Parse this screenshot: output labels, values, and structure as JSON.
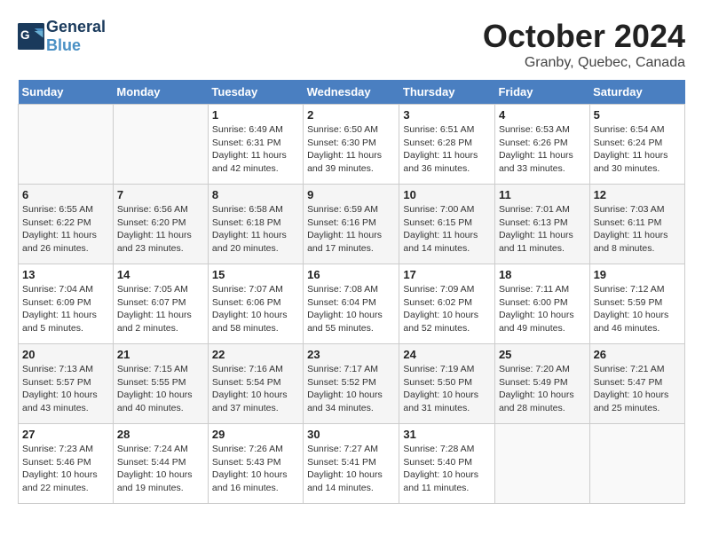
{
  "header": {
    "logo_line1": "General",
    "logo_line2": "Blue",
    "month": "October 2024",
    "location": "Granby, Quebec, Canada"
  },
  "weekdays": [
    "Sunday",
    "Monday",
    "Tuesday",
    "Wednesday",
    "Thursday",
    "Friday",
    "Saturday"
  ],
  "weeks": [
    [
      {
        "day": "",
        "sunrise": "",
        "sunset": "",
        "daylight": ""
      },
      {
        "day": "",
        "sunrise": "",
        "sunset": "",
        "daylight": ""
      },
      {
        "day": "1",
        "sunrise": "Sunrise: 6:49 AM",
        "sunset": "Sunset: 6:31 PM",
        "daylight": "Daylight: 11 hours and 42 minutes."
      },
      {
        "day": "2",
        "sunrise": "Sunrise: 6:50 AM",
        "sunset": "Sunset: 6:30 PM",
        "daylight": "Daylight: 11 hours and 39 minutes."
      },
      {
        "day": "3",
        "sunrise": "Sunrise: 6:51 AM",
        "sunset": "Sunset: 6:28 PM",
        "daylight": "Daylight: 11 hours and 36 minutes."
      },
      {
        "day": "4",
        "sunrise": "Sunrise: 6:53 AM",
        "sunset": "Sunset: 6:26 PM",
        "daylight": "Daylight: 11 hours and 33 minutes."
      },
      {
        "day": "5",
        "sunrise": "Sunrise: 6:54 AM",
        "sunset": "Sunset: 6:24 PM",
        "daylight": "Daylight: 11 hours and 30 minutes."
      }
    ],
    [
      {
        "day": "6",
        "sunrise": "Sunrise: 6:55 AM",
        "sunset": "Sunset: 6:22 PM",
        "daylight": "Daylight: 11 hours and 26 minutes."
      },
      {
        "day": "7",
        "sunrise": "Sunrise: 6:56 AM",
        "sunset": "Sunset: 6:20 PM",
        "daylight": "Daylight: 11 hours and 23 minutes."
      },
      {
        "day": "8",
        "sunrise": "Sunrise: 6:58 AM",
        "sunset": "Sunset: 6:18 PM",
        "daylight": "Daylight: 11 hours and 20 minutes."
      },
      {
        "day": "9",
        "sunrise": "Sunrise: 6:59 AM",
        "sunset": "Sunset: 6:16 PM",
        "daylight": "Daylight: 11 hours and 17 minutes."
      },
      {
        "day": "10",
        "sunrise": "Sunrise: 7:00 AM",
        "sunset": "Sunset: 6:15 PM",
        "daylight": "Daylight: 11 hours and 14 minutes."
      },
      {
        "day": "11",
        "sunrise": "Sunrise: 7:01 AM",
        "sunset": "Sunset: 6:13 PM",
        "daylight": "Daylight: 11 hours and 11 minutes."
      },
      {
        "day": "12",
        "sunrise": "Sunrise: 7:03 AM",
        "sunset": "Sunset: 6:11 PM",
        "daylight": "Daylight: 11 hours and 8 minutes."
      }
    ],
    [
      {
        "day": "13",
        "sunrise": "Sunrise: 7:04 AM",
        "sunset": "Sunset: 6:09 PM",
        "daylight": "Daylight: 11 hours and 5 minutes."
      },
      {
        "day": "14",
        "sunrise": "Sunrise: 7:05 AM",
        "sunset": "Sunset: 6:07 PM",
        "daylight": "Daylight: 11 hours and 2 minutes."
      },
      {
        "day": "15",
        "sunrise": "Sunrise: 7:07 AM",
        "sunset": "Sunset: 6:06 PM",
        "daylight": "Daylight: 10 hours and 58 minutes."
      },
      {
        "day": "16",
        "sunrise": "Sunrise: 7:08 AM",
        "sunset": "Sunset: 6:04 PM",
        "daylight": "Daylight: 10 hours and 55 minutes."
      },
      {
        "day": "17",
        "sunrise": "Sunrise: 7:09 AM",
        "sunset": "Sunset: 6:02 PM",
        "daylight": "Daylight: 10 hours and 52 minutes."
      },
      {
        "day": "18",
        "sunrise": "Sunrise: 7:11 AM",
        "sunset": "Sunset: 6:00 PM",
        "daylight": "Daylight: 10 hours and 49 minutes."
      },
      {
        "day": "19",
        "sunrise": "Sunrise: 7:12 AM",
        "sunset": "Sunset: 5:59 PM",
        "daylight": "Daylight: 10 hours and 46 minutes."
      }
    ],
    [
      {
        "day": "20",
        "sunrise": "Sunrise: 7:13 AM",
        "sunset": "Sunset: 5:57 PM",
        "daylight": "Daylight: 10 hours and 43 minutes."
      },
      {
        "day": "21",
        "sunrise": "Sunrise: 7:15 AM",
        "sunset": "Sunset: 5:55 PM",
        "daylight": "Daylight: 10 hours and 40 minutes."
      },
      {
        "day": "22",
        "sunrise": "Sunrise: 7:16 AM",
        "sunset": "Sunset: 5:54 PM",
        "daylight": "Daylight: 10 hours and 37 minutes."
      },
      {
        "day": "23",
        "sunrise": "Sunrise: 7:17 AM",
        "sunset": "Sunset: 5:52 PM",
        "daylight": "Daylight: 10 hours and 34 minutes."
      },
      {
        "day": "24",
        "sunrise": "Sunrise: 7:19 AM",
        "sunset": "Sunset: 5:50 PM",
        "daylight": "Daylight: 10 hours and 31 minutes."
      },
      {
        "day": "25",
        "sunrise": "Sunrise: 7:20 AM",
        "sunset": "Sunset: 5:49 PM",
        "daylight": "Daylight: 10 hours and 28 minutes."
      },
      {
        "day": "26",
        "sunrise": "Sunrise: 7:21 AM",
        "sunset": "Sunset: 5:47 PM",
        "daylight": "Daylight: 10 hours and 25 minutes."
      }
    ],
    [
      {
        "day": "27",
        "sunrise": "Sunrise: 7:23 AM",
        "sunset": "Sunset: 5:46 PM",
        "daylight": "Daylight: 10 hours and 22 minutes."
      },
      {
        "day": "28",
        "sunrise": "Sunrise: 7:24 AM",
        "sunset": "Sunset: 5:44 PM",
        "daylight": "Daylight: 10 hours and 19 minutes."
      },
      {
        "day": "29",
        "sunrise": "Sunrise: 7:26 AM",
        "sunset": "Sunset: 5:43 PM",
        "daylight": "Daylight: 10 hours and 16 minutes."
      },
      {
        "day": "30",
        "sunrise": "Sunrise: 7:27 AM",
        "sunset": "Sunset: 5:41 PM",
        "daylight": "Daylight: 10 hours and 14 minutes."
      },
      {
        "day": "31",
        "sunrise": "Sunrise: 7:28 AM",
        "sunset": "Sunset: 5:40 PM",
        "daylight": "Daylight: 10 hours and 11 minutes."
      },
      {
        "day": "",
        "sunrise": "",
        "sunset": "",
        "daylight": ""
      },
      {
        "day": "",
        "sunrise": "",
        "sunset": "",
        "daylight": ""
      }
    ]
  ]
}
